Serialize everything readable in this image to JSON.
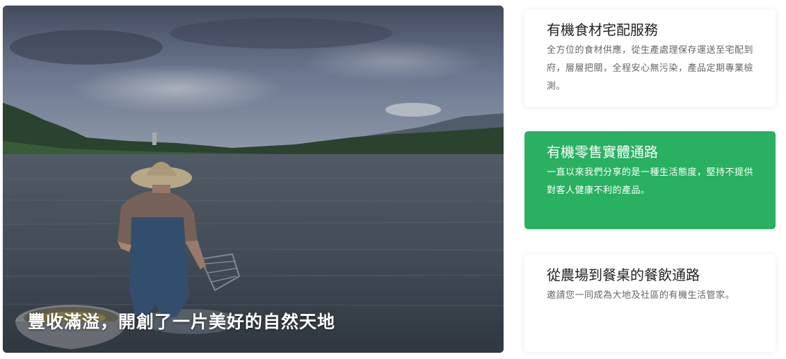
{
  "hero": {
    "caption": "豐收滿溢，開創了一片美好的自然天地"
  },
  "cards": [
    {
      "title": "有機食材宅配服務",
      "desc": "全方位的食材供應，從生產處理保存運送至宅配到府，層層把關，全程安心無污染，產品定期專業檢測。",
      "active": false
    },
    {
      "title": "有機零售實體通路",
      "desc": "一直以來我們分享的是一種生活態度，堅持不提供對客人健康不利的產品。",
      "active": true,
      "bg_color": "#29b061"
    },
    {
      "title": "從農場到餐桌的餐飲通路",
      "desc": "邀請您一同成為大地及社區的有機生活管家。",
      "active": false
    }
  ]
}
